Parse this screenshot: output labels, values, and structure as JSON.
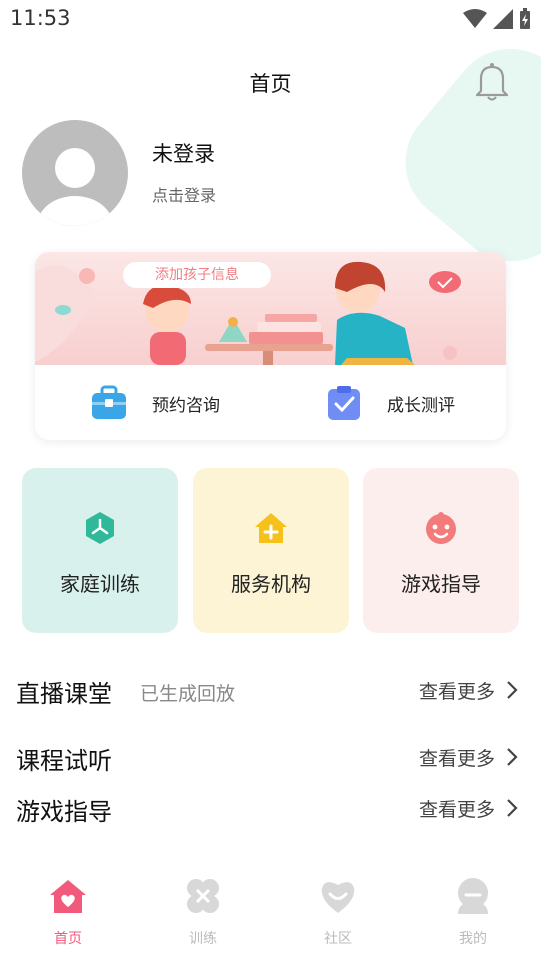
{
  "status_bar": {
    "time": "11:53"
  },
  "header": {
    "title": "首页"
  },
  "profile": {
    "name": "未登录",
    "login_prompt": "点击登录"
  },
  "banner": {
    "pill_label": "添加孩子信息"
  },
  "card_actions": [
    {
      "label": "预约咨询",
      "icon": "toolbox-icon"
    },
    {
      "label": "成长测评",
      "icon": "clipboard-check-icon"
    }
  ],
  "tiles": [
    {
      "label": "家庭训练",
      "icon": "cube-icon",
      "bg": "#d9f1ed"
    },
    {
      "label": "服务机构",
      "icon": "house-plus-icon",
      "bg": "#fcf4d5"
    },
    {
      "label": "游戏指导",
      "icon": "baby-face-icon",
      "bg": "#fdeeee"
    }
  ],
  "sections": [
    {
      "title": "直播课堂",
      "subtitle": "已生成回放",
      "more": "查看更多"
    },
    {
      "title": "课程试听",
      "subtitle": "",
      "more": "查看更多"
    },
    {
      "title": "游戏指导",
      "subtitle": "",
      "more": "查看更多"
    }
  ],
  "tabbar": [
    {
      "label": "首页",
      "icon": "home-icon",
      "active": true
    },
    {
      "label": "训练",
      "icon": "training-icon",
      "active": false
    },
    {
      "label": "社区",
      "icon": "community-icon",
      "active": false
    },
    {
      "label": "我的",
      "icon": "profile-icon",
      "active": false
    }
  ],
  "colors": {
    "accent": "#f25a7c",
    "inactive": "#d8d8d8"
  }
}
